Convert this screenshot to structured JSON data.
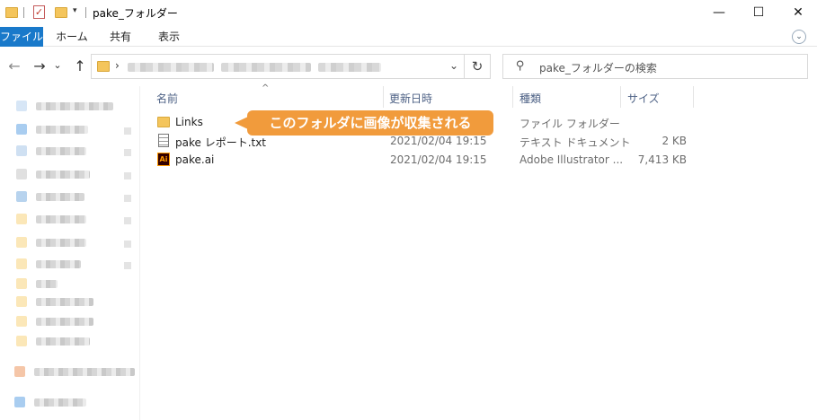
{
  "window": {
    "title": "pake_フォルダー",
    "minimize": "—",
    "maximize": "☐",
    "close": "✕"
  },
  "ribbon": {
    "tabs": [
      "ファイル",
      "ホーム",
      "共有",
      "表示"
    ],
    "expand": "⌄"
  },
  "nav": {
    "back": "←",
    "forward": "→",
    "recent": "⌄",
    "up": "↑",
    "address_chevron": "›",
    "address_dropdown": "⌄",
    "refresh": "↻",
    "search_icon": "⚲",
    "search_placeholder": "pake_フォルダーの検索"
  },
  "columns": {
    "name": "名前",
    "modified": "更新日時",
    "type": "種類",
    "size": "サイズ",
    "sort_indicator": "^"
  },
  "files": [
    {
      "name": "Links",
      "modified": "",
      "type": "ファイル フォルダー",
      "size": "",
      "icon": "folder-icon"
    },
    {
      "name": "pake レポート.txt",
      "modified": "2021/02/04 19:15",
      "type": "テキスト ドキュメント",
      "size": "2 KB",
      "icon": "text-file-icon"
    },
    {
      "name": "pake.ai",
      "modified": "2021/02/04 19:15",
      "type": "Adobe Illustrator ...",
      "size": "7,413 KB",
      "icon": "illustrator-file-icon"
    }
  ],
  "annotation": {
    "text": "このフォルダに画像が収集される",
    "color": "#f19b3c"
  },
  "icons": {
    "ai_glyph": "Ai",
    "checklist_glyph": "✓",
    "qa_dropdown": "▾"
  },
  "colors": {
    "accent": "#1979ca",
    "folder": "#f4c55c",
    "header_text": "#4d6185"
  }
}
